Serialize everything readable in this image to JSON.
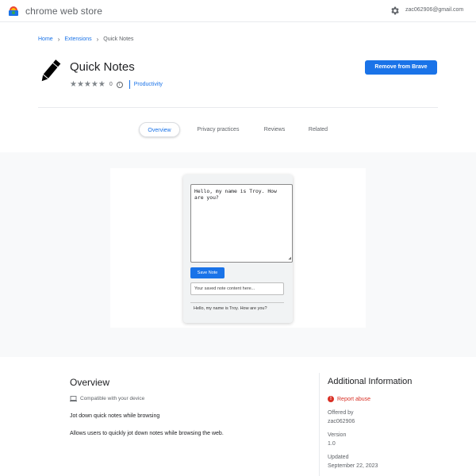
{
  "header": {
    "store_title": "chrome web store",
    "account": "zac062906@gmail.com",
    "icons": [
      "chrome-web-store-logo-icon",
      "gear-icon"
    ]
  },
  "breadcrumb": {
    "items": [
      "Home",
      "Extensions",
      "Quick Notes"
    ]
  },
  "extension": {
    "name": "Quick Notes",
    "icon": "pencil-icon",
    "stars": "★★★★★",
    "rating_count": "0",
    "category": "Productivity",
    "action_label": "Remove from Brave"
  },
  "tabs": [
    {
      "label": "Overview",
      "active": true
    },
    {
      "label": "Privacy practices",
      "active": false
    },
    {
      "label": "Reviews",
      "active": false
    },
    {
      "label": "Related",
      "active": false
    }
  ],
  "screenshot": {
    "note_text": "Hello, my name is Troy. How are you?",
    "save_label": "Save Note",
    "saved_placeholder": "Your saved note content here...",
    "saved_text": "Hello, my name is Troy. How are you?"
  },
  "overview": {
    "heading": "Overview",
    "compat": "Compatible with your device",
    "summary": "Jot down quick notes while browsing",
    "description": "Allows users to quickly jot down notes while browsing the web."
  },
  "additional": {
    "heading": "Additional Information",
    "report_label": "Report abuse",
    "offered_by_label": "Offered by",
    "offered_by": "zac062906",
    "version_label": "Version",
    "version": "1.0",
    "updated_label": "Updated",
    "updated": "September 22, 2023"
  },
  "colors": {
    "accent": "#1a73e8",
    "danger": "#d93025"
  }
}
